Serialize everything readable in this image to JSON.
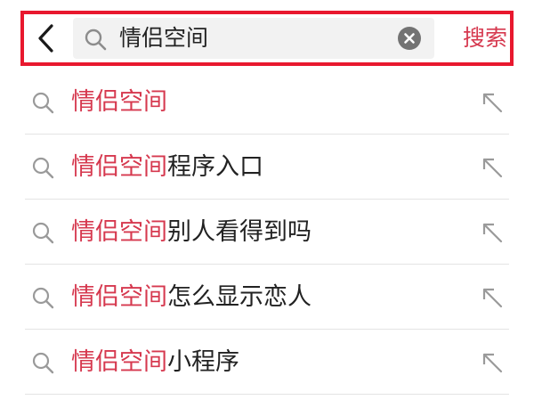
{
  "search_bar": {
    "back_icon": "chevron-left-icon",
    "search_icon": "search-icon",
    "query": "情侣空间",
    "clear_icon": "clear-circle-icon",
    "search_button_label": "搜索",
    "highlight_border_color": "#e8182e"
  },
  "suggestions": {
    "highlight_color": "#d6394f",
    "item_icon": "search-icon",
    "fill_icon": "arrow-up-left-icon",
    "items": [
      {
        "highlight": "情侣空间",
        "rest": ""
      },
      {
        "highlight": "情侣空间",
        "rest": "程序入口"
      },
      {
        "highlight": "情侣空间",
        "rest": "别人看得到吗"
      },
      {
        "highlight": "情侣空间",
        "rest": "怎么显示恋人"
      },
      {
        "highlight": "情侣空间",
        "rest": "小程序"
      }
    ]
  }
}
